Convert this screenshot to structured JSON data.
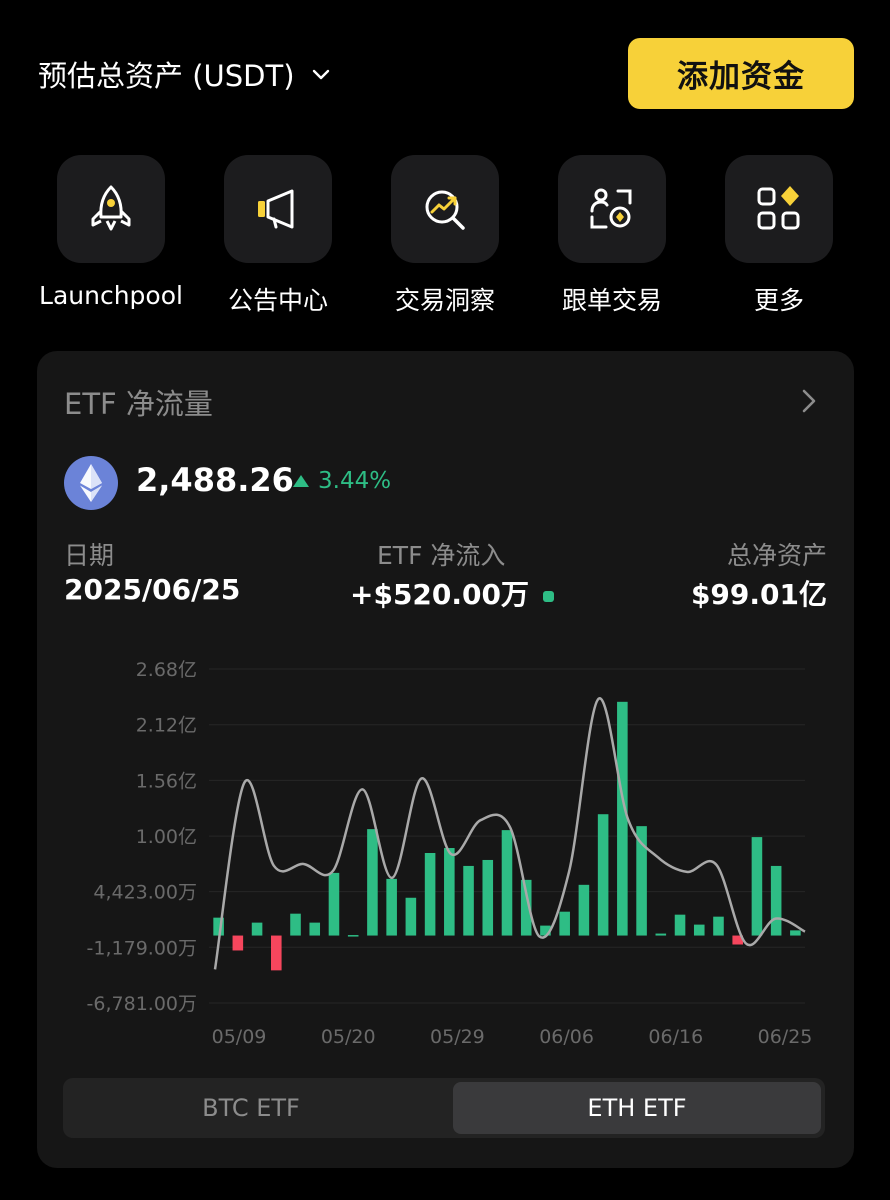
{
  "header": {
    "title": "预估总资产 (USDT)",
    "add_funds_label": "添加资金"
  },
  "shortcuts": [
    {
      "label": "Launchpool",
      "icon": "rocket-icon"
    },
    {
      "label": "公告中心",
      "icon": "megaphone-icon"
    },
    {
      "label": "交易洞察",
      "icon": "insight-icon"
    },
    {
      "label": "跟单交易",
      "icon": "copy-trade-icon"
    },
    {
      "label": "更多",
      "icon": "more-grid-icon"
    }
  ],
  "etf_card": {
    "title": "ETF 净流量",
    "price": "2,488.26",
    "change": "3.44%",
    "date_label": "日期",
    "date_value": "2025/06/25",
    "inflow_label": "ETF 净流入",
    "inflow_value": "+$520.00万",
    "nav_label": "总净资产",
    "nav_value": "$99.01亿",
    "tabs": [
      {
        "label": "BTC ETF",
        "active": false
      },
      {
        "label": "ETH ETF",
        "active": true
      }
    ]
  },
  "colors": {
    "accent": "#f7d139",
    "positive": "#2ebd85",
    "negative": "#f6465d",
    "card": "#161616"
  },
  "chart_data": {
    "type": "bar",
    "y_tick_labels": [
      "2.68亿",
      "2.12亿",
      "1.56亿",
      "1.00亿",
      "4,423.00万",
      "-1,179.00万",
      "-6,781.00万"
    ],
    "y_ticks_wan": [
      26800,
      21200,
      15600,
      10000,
      4423,
      -1179,
      -6781
    ],
    "x_tick_labels": [
      "05/09",
      "05/20",
      "05/29",
      "06/06",
      "06/16",
      "06/25"
    ],
    "unit": "万",
    "ylim_wan": [
      -6781,
      26800
    ],
    "values_wan": [
      1800,
      -1500,
      1300,
      -3500,
      2200,
      1300,
      6300,
      50,
      10700,
      5700,
      3800,
      8300,
      8800,
      7000,
      7600,
      10600,
      5600,
      1000,
      2400,
      5100,
      12200,
      23500,
      11000,
      200,
      2100,
      1100,
      1900,
      -900,
      9900,
      7000,
      520
    ],
    "flow_line_wan": [
      -3400,
      15400,
      7000,
      7200,
      6500,
      14700,
      5800,
      15800,
      8200,
      11600,
      10900,
      -100,
      6400,
      23800,
      11700,
      7900,
      6400,
      7100,
      -800,
      1700,
      400
    ]
  }
}
